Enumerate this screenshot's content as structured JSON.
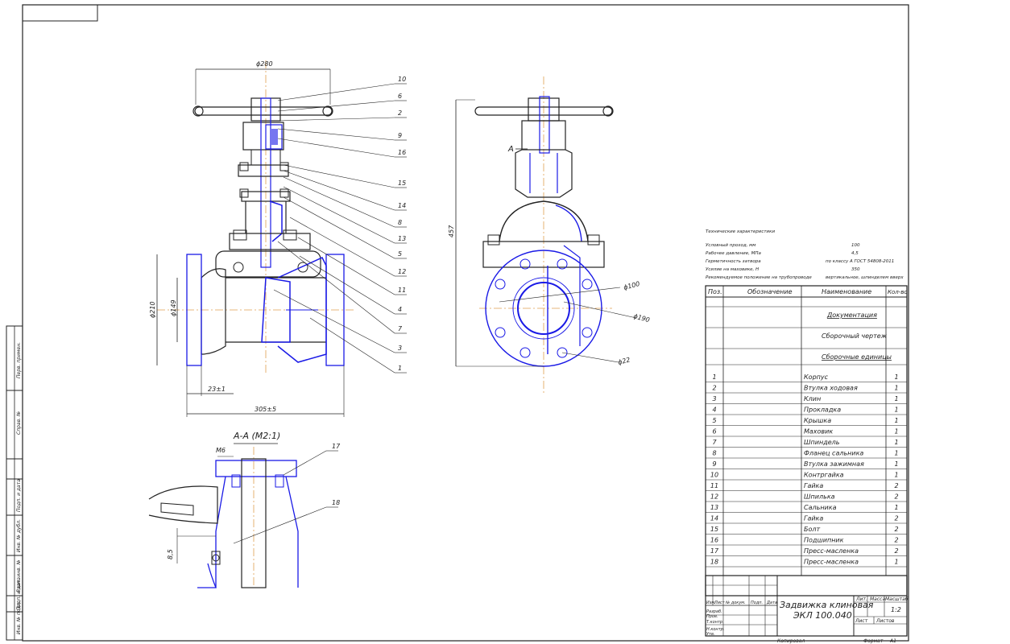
{
  "dimensions": {
    "handwheel_dia": "ϕ280",
    "flange_dia": "ϕ210",
    "bore_dia": "ϕ149",
    "flange_thk": "23±1",
    "face_to_face": "305±5",
    "height": "457",
    "dn": "ϕ100",
    "bolt_circle": "ϕ190",
    "hole_dia": "ϕ22",
    "thread": "M6",
    "detail_dim": "8,5"
  },
  "section_label": "А-А (М2:1)",
  "view_marker": "А",
  "callouts_front": [
    "10",
    "6",
    "2",
    "9",
    "16",
    "15",
    "14",
    "8",
    "13",
    "5",
    "12",
    "11",
    "4",
    "7",
    "3",
    "1"
  ],
  "callouts_detail": [
    "17",
    "18"
  ],
  "tech": {
    "title": "Технические характеристики",
    "rows": [
      {
        "k": "Условный проход, мм",
        "v": "100"
      },
      {
        "k": "Рабочее давление, МПа",
        "v": "4,5"
      },
      {
        "k": "Герметичность затвора",
        "v": "по классу А ГОСТ 54808-2011"
      },
      {
        "k": "Усилие на маховике, Н",
        "v": "350"
      },
      {
        "k": "Рекомендуемое положение на трубопроводе",
        "v": "вертикальное, шпинделем вверх"
      }
    ]
  },
  "spec": {
    "headers": {
      "pos": "Поз.",
      "desig": "Обозначение",
      "name": "Наименование",
      "qty": "Кол-во"
    },
    "sections": [
      "Документация",
      "Сборочный чертеж",
      "Сборочные единицы"
    ],
    "items": [
      {
        "pos": "1",
        "name": "Корпус",
        "qty": "1"
      },
      {
        "pos": "2",
        "name": "Втулка ходовая",
        "qty": "1"
      },
      {
        "pos": "3",
        "name": "Клин",
        "qty": "1"
      },
      {
        "pos": "4",
        "name": "Прокладка",
        "qty": "1"
      },
      {
        "pos": "5",
        "name": "Крышка",
        "qty": "1"
      },
      {
        "pos": "6",
        "name": "Маховик",
        "qty": "1"
      },
      {
        "pos": "7",
        "name": "Шпиндель",
        "qty": "1"
      },
      {
        "pos": "8",
        "name": "Фланец сальника",
        "qty": "1"
      },
      {
        "pos": "9",
        "name": "Втулка зажимная",
        "qty": "1"
      },
      {
        "pos": "10",
        "name": "Контргайка",
        "qty": "1"
      },
      {
        "pos": "11",
        "name": "Гайка",
        "qty": "2"
      },
      {
        "pos": "12",
        "name": "Шпилька",
        "qty": "2"
      },
      {
        "pos": "13",
        "name": "Сальника",
        "qty": "1"
      },
      {
        "pos": "14",
        "name": "Гайка",
        "qty": "2"
      },
      {
        "pos": "15",
        "name": "Болт",
        "qty": "2"
      },
      {
        "pos": "16",
        "name": "Подшипник",
        "qty": "2"
      },
      {
        "pos": "17",
        "name": "Пресс-масленка",
        "qty": "2"
      },
      {
        "pos": "18",
        "name": "Пресс-масленка",
        "qty": "1"
      }
    ]
  },
  "title_block": {
    "title_line1": "Задвижка клиновая",
    "title_line2": "ЭКЛ 100.040",
    "col_lit": "Лит.",
    "col_mass": "Масса",
    "col_scale": "Масштаб",
    "scale": "1:2",
    "sheet": "Лист",
    "sheets": "Листов",
    "row_labels": [
      "Изм.",
      "Лист",
      "№ докум.",
      "Подп.",
      "Дата"
    ],
    "roles": [
      "Разраб.",
      "Пров.",
      "Т.контр.",
      "Н.контр.",
      "Утв."
    ],
    "copied": "Копировал",
    "format": "Формат",
    "format_val": "А1"
  },
  "side_stamp": [
    "Инв. № подл.",
    "Подп. и дата",
    "Взам. инв. №",
    "Инв. № дубл.",
    "Подп. и дата",
    "Справ. №",
    "Перв. примен."
  ]
}
